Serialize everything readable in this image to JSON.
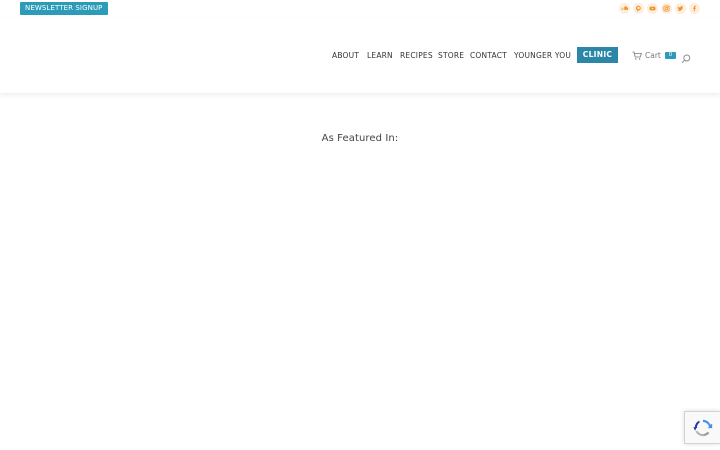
{
  "topbar": {
    "newsletter_label": "NEWSLETTER SIGNUP",
    "socials": [
      "soundcloud-icon",
      "pinterest-icon",
      "youtube-icon",
      "instagram-icon",
      "twitter-icon",
      "facebook-icon"
    ],
    "social_icon_color": "#f0932b"
  },
  "nav": {
    "items": [
      "ABOUT",
      "LEARN",
      "RECIPES",
      "STORE",
      "CONTACT",
      "YOUNGER YOU"
    ],
    "clinic_label": "CLINIC",
    "cart_label": "Cart",
    "cart_count": "0"
  },
  "main": {
    "featured_heading": "As Featured In:"
  },
  "colors": {
    "accent": "#2b9bb8",
    "clinic": "#2b86a8"
  }
}
